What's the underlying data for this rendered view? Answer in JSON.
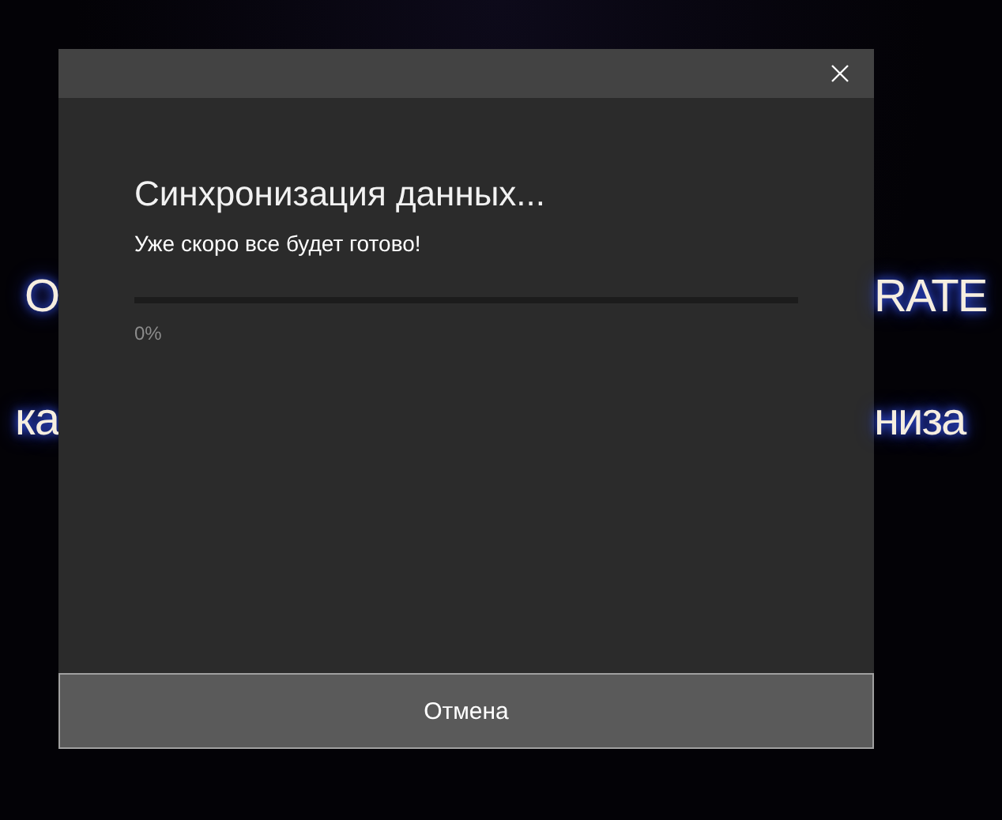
{
  "background": {
    "left_fragments": [
      "O",
      "ка"
    ],
    "right_fragments": [
      "RATE",
      "низа"
    ]
  },
  "dialog": {
    "title": "Синхронизация данных...",
    "message": "Уже скоро все будет готово!",
    "progress": {
      "level": 0,
      "reading": "0%"
    },
    "buttons": [
      "Отмена"
    ]
  }
}
